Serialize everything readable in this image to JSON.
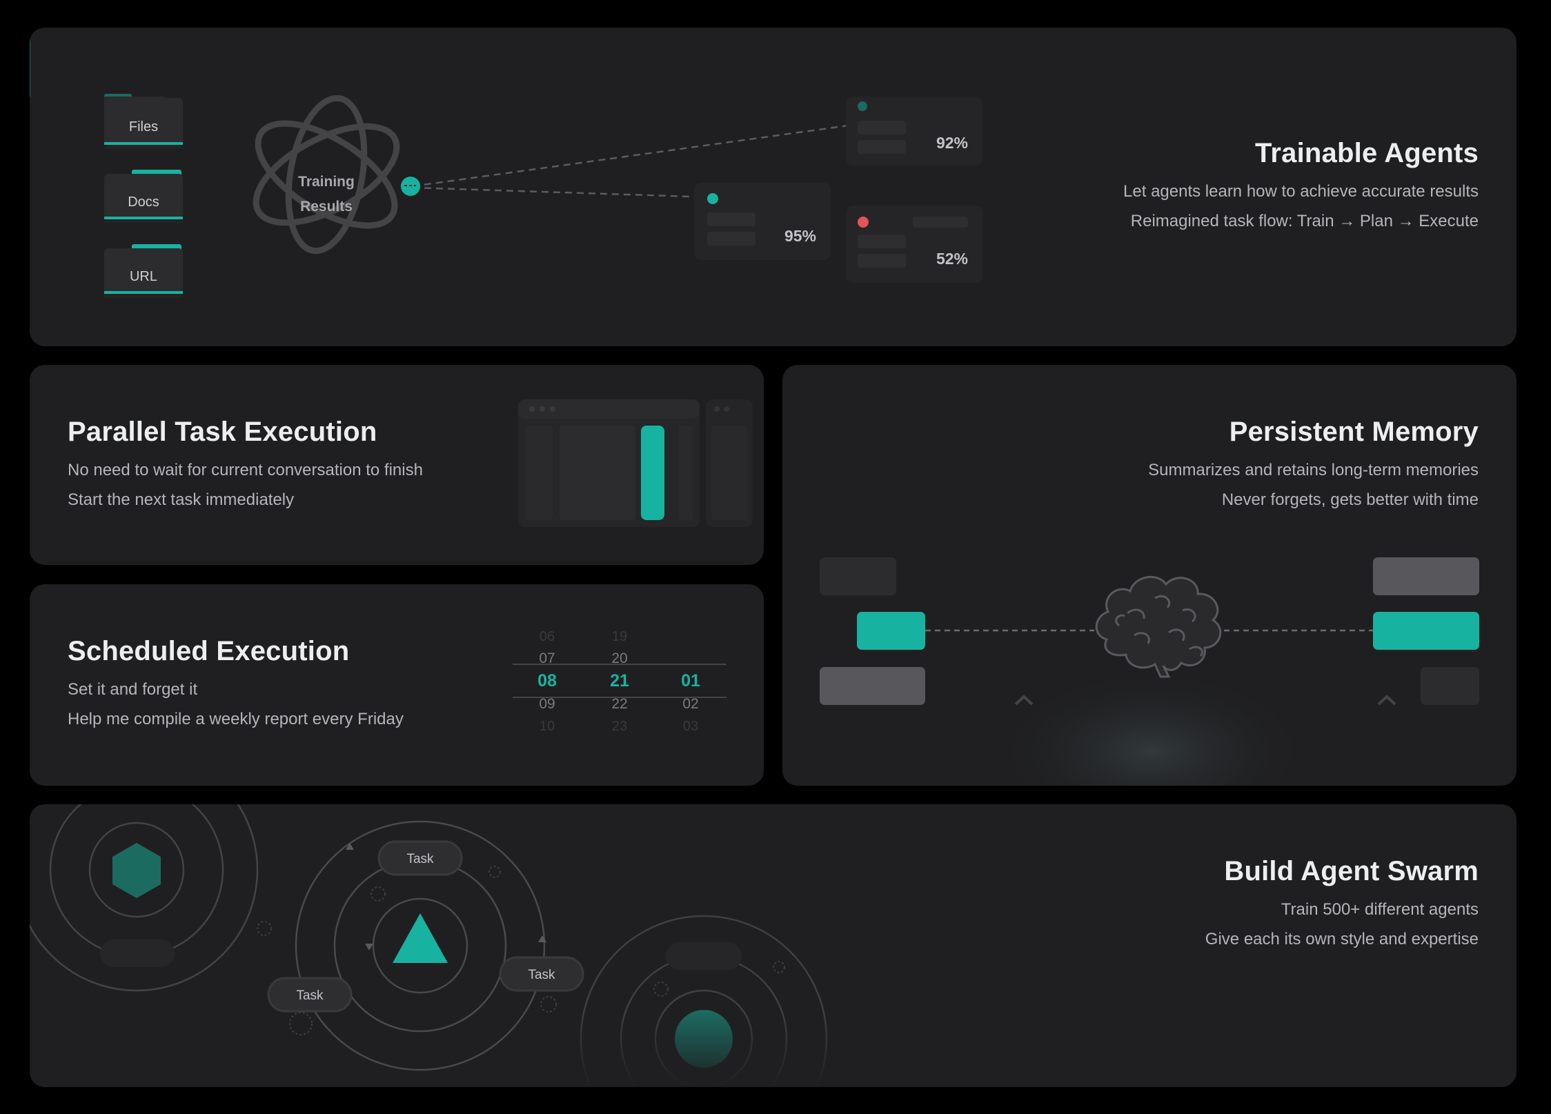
{
  "colors": {
    "accent": "#17b3a0",
    "card": "#1f1f21",
    "background": "#000000",
    "danger": "#e05555"
  },
  "trainable": {
    "title": "Trainable Agents",
    "line1": "Let agents learn how to achieve accurate results",
    "line2": "Reimagined task flow: Train → Plan → Execute",
    "sources": [
      {
        "label": "Files"
      },
      {
        "label": "Docs"
      },
      {
        "label": "URL"
      }
    ],
    "training_line1": "Training",
    "training_line2": "Results",
    "scores": [
      {
        "value": "92%"
      },
      {
        "value": "95%"
      },
      {
        "value": "52%"
      }
    ]
  },
  "parallel": {
    "title": "Parallel Task Execution",
    "line1": "No need to wait for current conversation to finish",
    "line2": "Start the next task immediately"
  },
  "scheduled": {
    "title": "Scheduled Execution",
    "line1": "Set it and forget it",
    "line2": "Help me compile a weekly report every Friday",
    "picker": {
      "col1": [
        "06",
        "07",
        "08",
        "09",
        "10"
      ],
      "col2": [
        "19",
        "20",
        "21",
        "22",
        "23"
      ],
      "col3": [
        "",
        "",
        "01",
        "02",
        "03"
      ]
    }
  },
  "memory": {
    "title": "Persistent Memory",
    "line1": "Summarizes and retains long-term memories",
    "line2": "Never forgets, gets better with time",
    "icon": "brain-icon"
  },
  "swarm": {
    "title": "Build Agent Swarm",
    "line1": "Train 500+ different agents",
    "line2": "Give each its own style and expertise",
    "task_labels": [
      {
        "label": "Task"
      },
      {
        "label": "Task"
      },
      {
        "label": "Task"
      }
    ]
  }
}
